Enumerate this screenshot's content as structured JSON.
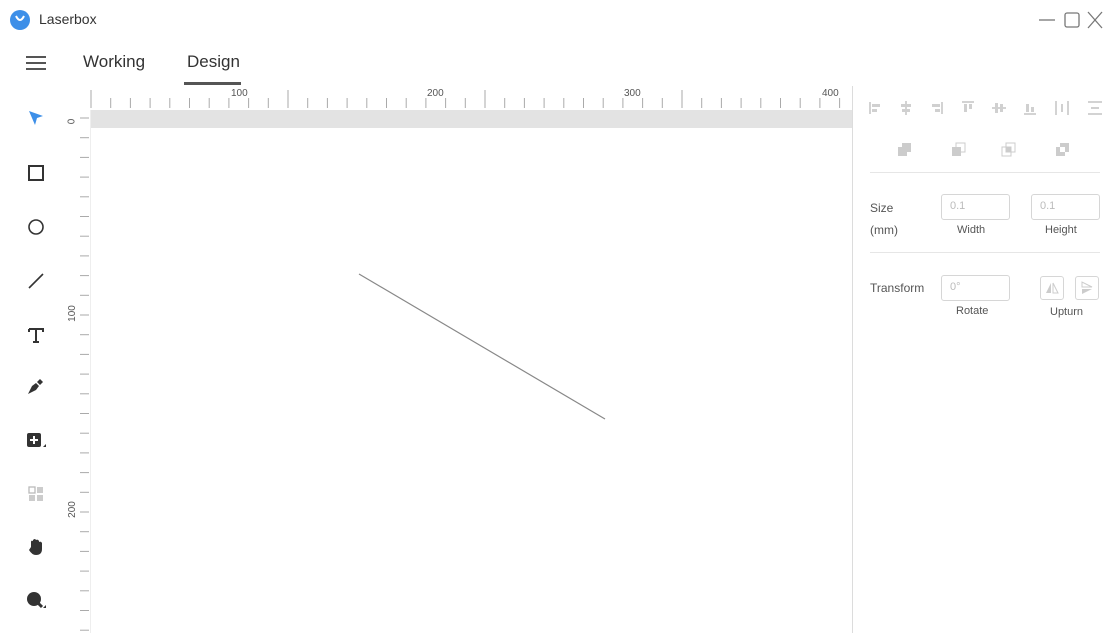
{
  "app": {
    "title": "Laserbox",
    "accent": "#3d8fe8"
  },
  "window_controls": [
    "minimize-icon",
    "maximize-icon",
    "close-icon"
  ],
  "menu": {
    "icon": "hamburger-icon"
  },
  "tabs": [
    {
      "label": "Working"
    },
    {
      "label": "Design",
      "active": true
    }
  ],
  "tools": [
    {
      "name": "select",
      "icon": "cursor-arrow-icon",
      "active": true
    },
    {
      "name": "rectangle",
      "icon": "square-icon"
    },
    {
      "name": "ellipse",
      "icon": "circle-icon"
    },
    {
      "name": "line",
      "icon": "line-icon"
    },
    {
      "name": "text",
      "icon": "text-icon"
    },
    {
      "name": "pen",
      "icon": "pen-icon"
    },
    {
      "name": "insert",
      "icon": "add-image-icon"
    },
    {
      "name": "array",
      "icon": "grid-icon",
      "disabled": true
    },
    {
      "name": "pan",
      "icon": "hand-icon"
    },
    {
      "name": "zoom",
      "icon": "zoom-icon"
    }
  ],
  "rulers": {
    "top": [
      "100",
      "200",
      "300",
      "400"
    ],
    "left": [
      "0",
      "100",
      "200"
    ]
  },
  "canvas": {
    "shape": "line",
    "stroke": "#888888"
  },
  "panel": {
    "align_icons": [
      "align-left-icon",
      "align-center-horizontal-icon",
      "align-right-icon",
      "align-top-icon",
      "align-center-vertical-icon",
      "align-bottom-icon",
      "distribute-horizontal-icon",
      "distribute-vertical-icon"
    ],
    "boolean_icons": [
      "union-icon",
      "subtract-icon",
      "intersect-icon",
      "exclude-icon"
    ],
    "size": {
      "label": "Size",
      "unit": "(mm)",
      "width_value": "0.1",
      "width_label": "Width",
      "height_value": "0.1",
      "height_label": "Height"
    },
    "transform": {
      "label": "Transform",
      "rotate_value": "0°",
      "rotate_label": "Rotate",
      "upturn_label": "Upturn"
    }
  }
}
